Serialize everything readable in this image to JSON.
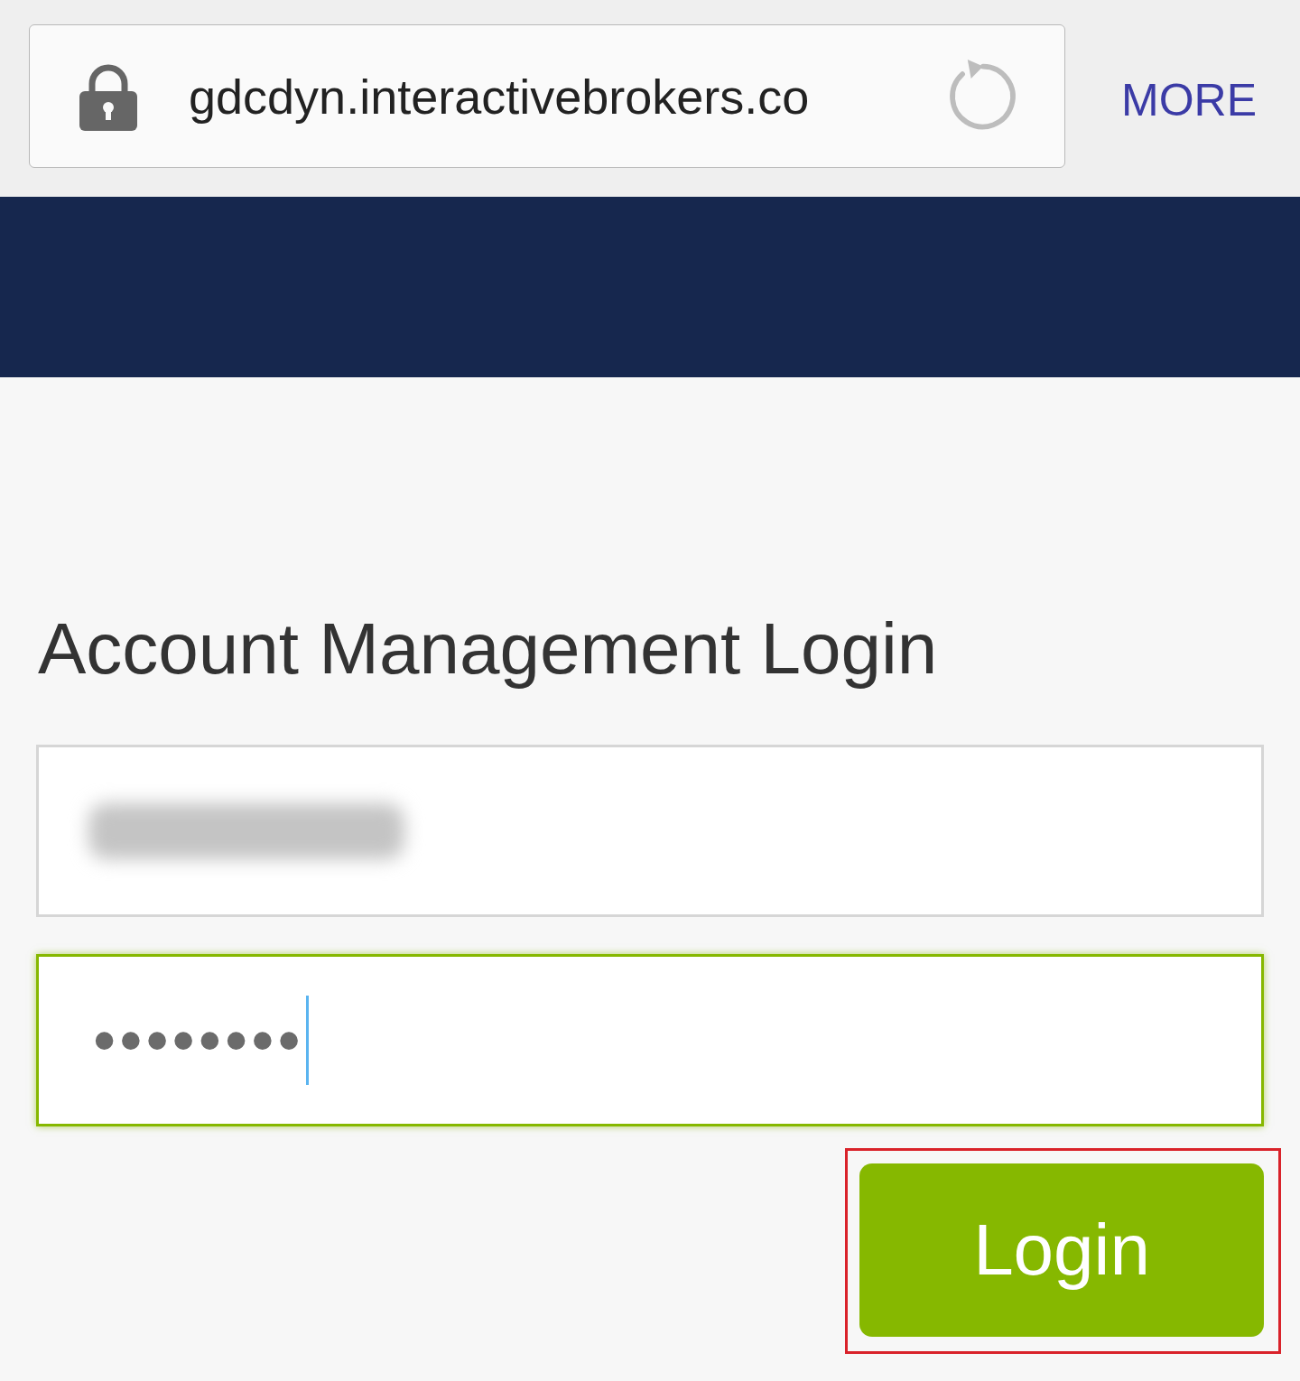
{
  "browser_bar": {
    "secure": true,
    "url": "gdcdyn.interactivebrokers.co",
    "more": "MORE"
  },
  "login": {
    "title": "Account Management Login",
    "fields": [
      {
        "kind": "text",
        "redacted": true,
        "focused": false
      },
      {
        "kind": "password",
        "value": "••••••••",
        "focused": true
      }
    ],
    "button": {
      "label": "Login",
      "highlighted": true
    }
  }
}
